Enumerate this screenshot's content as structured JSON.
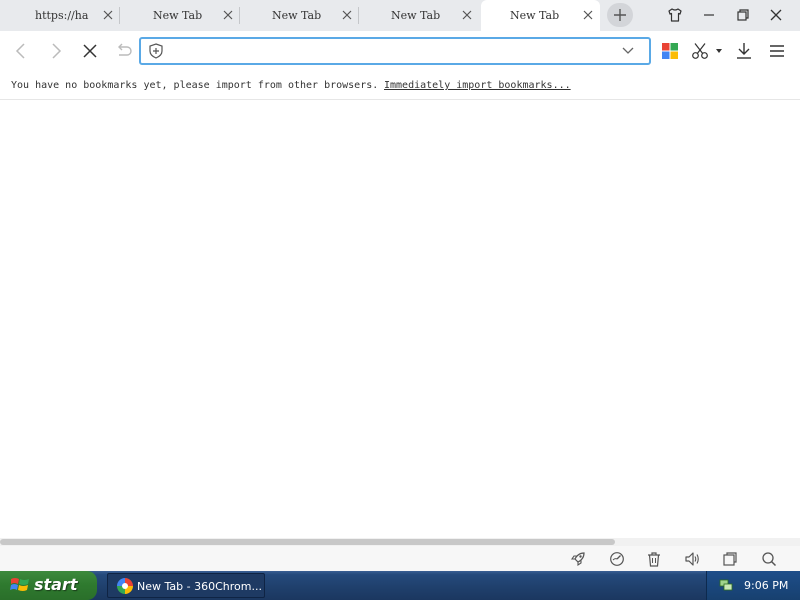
{
  "tabs": [
    {
      "label": "https://ha",
      "active": false
    },
    {
      "label": "New Tab",
      "active": false
    },
    {
      "label": "New Tab",
      "active": false
    },
    {
      "label": "New Tab",
      "active": false
    },
    {
      "label": "New Tab",
      "active": true
    }
  ],
  "icons": {
    "new_tab": "plus-icon",
    "skin": "shirt-icon",
    "minimize": "minimize-icon",
    "restore": "restore-icon",
    "close": "close-icon",
    "back": "arrow-left-icon",
    "forward": "arrow-right-icon",
    "stop": "stop-icon",
    "undo": "undo-icon",
    "shield": "shield-icon",
    "apps": "apps-grid-icon",
    "screenshot": "scissors-icon",
    "download": "download-icon",
    "menu": "menu-icon"
  },
  "address_bar": {
    "value": "",
    "placeholder": ""
  },
  "bookmark_bar": {
    "message": "You have no bookmarks yet, please import from other browsers.",
    "import_link": "Immediately import bookmarks..."
  },
  "taskbar": {
    "start_label": "start",
    "window_title": "New Tab - 360Chrom...",
    "clock": "9:06 PM"
  },
  "colors": {
    "accent": "#5aa9e6",
    "tab_strip": "#e8eaed",
    "apps_red": "#e94335",
    "apps_green": "#34a853",
    "apps_blue": "#4285f4",
    "apps_yellow": "#fbbc05"
  }
}
